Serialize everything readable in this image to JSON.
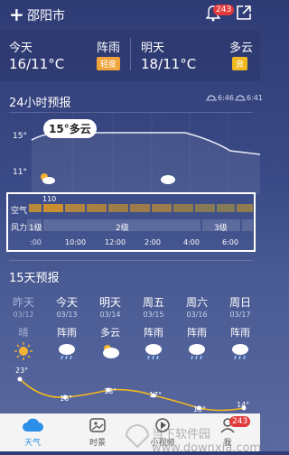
{
  "header": {
    "plus_icon": "+",
    "city": "邵阳市",
    "notification_count": "243"
  },
  "today": {
    "label": "今天",
    "temp": "16/11°C",
    "condition": "阵雨",
    "aqi": "轻度",
    "aqi_color": "#f2a33a"
  },
  "tomorrow": {
    "label": "明天",
    "temp": "18/11°C",
    "condition": "多云",
    "aqi": "良",
    "aqi_color": "#f2b81f"
  },
  "hourly": {
    "title": "24小时预报",
    "sunrise": "6:46",
    "sunset": "6:41",
    "tooltip": "15°多云",
    "y_ticks": [
      "15°",
      "11°"
    ],
    "air_label": "空气",
    "air_value": "110",
    "wind_label": "风力",
    "wind_levels": [
      "1级",
      "2级",
      "3级"
    ],
    "times": [
      ":00",
      "10:00",
      "12:00",
      "2:00",
      "4:00",
      "6:00"
    ]
  },
  "daily": {
    "title": "15天预报",
    "days": [
      {
        "name": "昨天",
        "date": "03/12",
        "cond": "晴",
        "icon": "sun-icon"
      },
      {
        "name": "今天",
        "date": "03/13",
        "cond": "阵雨",
        "icon": "rain-cloud-icon"
      },
      {
        "name": "明天",
        "date": "03/14",
        "cond": "多云",
        "icon": "cloud-icon"
      },
      {
        "name": "周五",
        "date": "03/15",
        "cond": "阵雨",
        "icon": "rain-cloud-icon"
      },
      {
        "name": "周六",
        "date": "03/16",
        "cond": "阵雨",
        "icon": "rain-cloud-icon"
      },
      {
        "name": "周日",
        "date": "03/17",
        "cond": "阵雨",
        "icon": "rain-cloud-icon"
      }
    ],
    "temps": [
      "23°",
      "16°",
      "18°",
      "17°",
      "13°",
      "14°"
    ]
  },
  "tabs": [
    {
      "label": "天气",
      "icon": "weather-tab-icon",
      "active": true
    },
    {
      "label": "时景",
      "icon": "photo-tab-icon",
      "active": false
    },
    {
      "label": "小视频",
      "icon": "video-tab-icon",
      "active": false
    },
    {
      "label": "我",
      "icon": "profile-tab-icon",
      "active": false
    }
  ],
  "watermark": "当下软件园 www.downxia.com"
}
